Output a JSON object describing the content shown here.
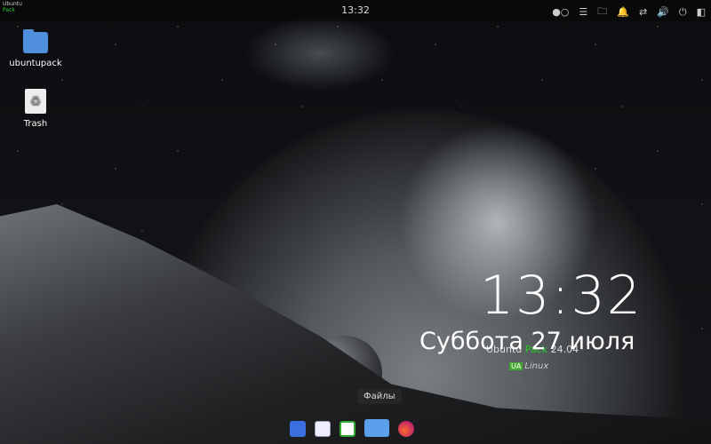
{
  "topbar": {
    "clock": "13:32",
    "corner_logo": [
      "Ubuntu",
      "Pack"
    ],
    "tray": [
      {
        "icon": "workspace-indicator-icon",
        "glyph": "●○"
      },
      {
        "icon": "menu-icon",
        "glyph": "☰"
      },
      {
        "icon": "folder-icon",
        "glyph": "🗀"
      },
      {
        "icon": "bell-icon",
        "glyph": "🔔"
      },
      {
        "icon": "network-icon",
        "glyph": "⇄"
      },
      {
        "icon": "volume-icon",
        "glyph": "🔊"
      },
      {
        "icon": "power-icon",
        "glyph": "⏻"
      },
      {
        "icon": "show-desktop-icon",
        "glyph": "◧"
      }
    ]
  },
  "desktop": {
    "icons": [
      {
        "label": "ubuntupack"
      },
      {
        "label": "Trash"
      }
    ]
  },
  "widget": {
    "time": "13:32",
    "date": "Суббота 27 июля",
    "brand_a": "Ubuntu",
    "brand_b": "Pack",
    "brand_c": "24.04",
    "linux_badge": "UA",
    "linux_text": "Linux"
  },
  "dock": {
    "tooltip": "Файлы"
  }
}
